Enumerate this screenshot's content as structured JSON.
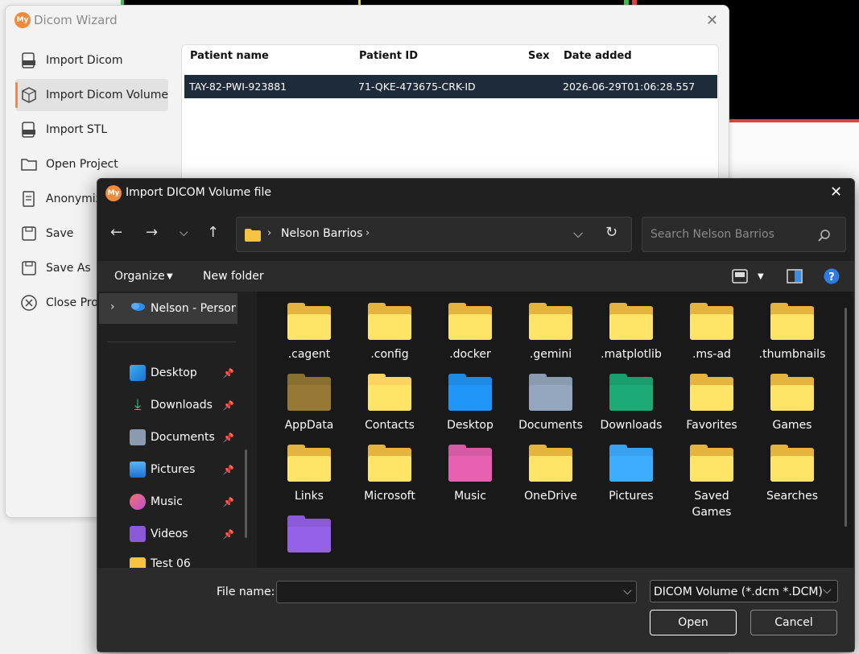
{
  "wizard": {
    "logo_text": "My",
    "title": "Dicom Wizard",
    "close": "✕",
    "nav": [
      {
        "label": "Import Dicom",
        "icon": "dicom-file-icon"
      },
      {
        "label": "Import Dicom Volume",
        "icon": "cube-volume-icon",
        "active": true
      },
      {
        "label": "Import STL",
        "icon": "stl-file-icon"
      },
      {
        "label": "Open Project",
        "icon": "folder-icon"
      },
      {
        "label": "Anonymize",
        "icon": "anonymize-icon"
      },
      {
        "label": "Save",
        "icon": "save-icon"
      },
      {
        "label": "Save As",
        "icon": "save-as-icon"
      },
      {
        "label": "Close Project",
        "icon": "close-circle-icon"
      }
    ],
    "table": {
      "headers": [
        "Patient name",
        "Patient ID",
        "Sex",
        "Date added"
      ],
      "rows": [
        {
          "name": "TAY-82-PWI-923881",
          "id": "71-QKE-473675-CRK-ID",
          "sex": "",
          "date": "2026-06-29T01:06:28.557"
        }
      ]
    }
  },
  "dialog": {
    "logo_text": "My",
    "title": "Import DICOM Volume file",
    "close": "✕",
    "address": {
      "path": "Nelson Barrios"
    },
    "search_placeholder": "Search Nelson Barrios",
    "toolbar": {
      "organize": "Organize",
      "new_folder": "New folder"
    },
    "sidebar": [
      {
        "label": "Nelson - Persona",
        "icon": "onedrive-cloud-icon"
      },
      {
        "label": "Desktop",
        "icon": "desktop-icon",
        "pinned": true
      },
      {
        "label": "Downloads",
        "icon": "downloads-icon",
        "pinned": true
      },
      {
        "label": "Documents",
        "icon": "documents-icon",
        "pinned": true
      },
      {
        "label": "Pictures",
        "icon": "pictures-icon",
        "pinned": true
      },
      {
        "label": "Music",
        "icon": "music-icon",
        "pinned": true
      },
      {
        "label": "Videos",
        "icon": "videos-icon",
        "pinned": true
      },
      {
        "label": "Test 06",
        "icon": "folder-icon"
      }
    ],
    "folders": [
      ".cagent",
      ".config",
      ".docker",
      ".gemini",
      ".matplotlib",
      ".ms-ad",
      ".thumbnails",
      "AppData",
      "Contacts",
      "Desktop",
      "Documents",
      "Downloads",
      "Favorites",
      "Games",
      "Links",
      "Microsoft",
      "Music",
      "OneDrive",
      "Pictures",
      "Saved Games",
      "Searches",
      ""
    ],
    "filename_label": "File name:",
    "filename_value": "",
    "filter": "DICOM Volume (*.dcm *.DCM)",
    "open_label": "Open",
    "cancel_label": "Cancel"
  },
  "colors": {
    "accent": "#f08a3c",
    "folder": "#ffd35f",
    "selection": "#1e2b3a"
  }
}
